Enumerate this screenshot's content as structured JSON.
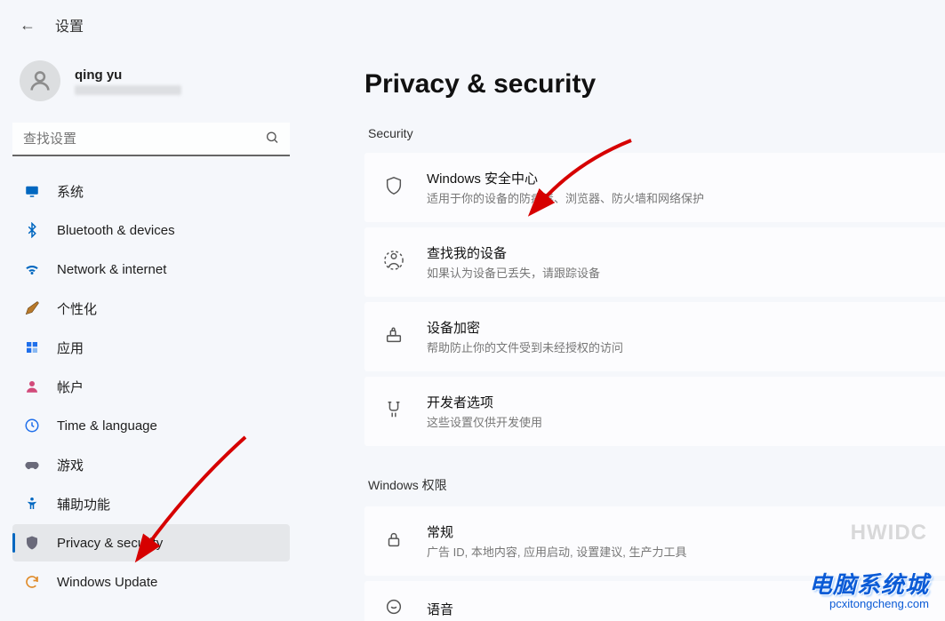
{
  "header": {
    "title": "设置"
  },
  "user": {
    "name": "qing yu"
  },
  "search": {
    "placeholder": "查找设置"
  },
  "nav": [
    {
      "key": "system",
      "label": "系统"
    },
    {
      "key": "bluetooth",
      "label": "Bluetooth & devices"
    },
    {
      "key": "network",
      "label": "Network & internet"
    },
    {
      "key": "personalize",
      "label": "个性化"
    },
    {
      "key": "apps",
      "label": "应用"
    },
    {
      "key": "accounts",
      "label": "帐户"
    },
    {
      "key": "time",
      "label": "Time & language"
    },
    {
      "key": "gaming",
      "label": "游戏"
    },
    {
      "key": "access",
      "label": "辅助功能"
    },
    {
      "key": "privacy",
      "label": "Privacy & security"
    },
    {
      "key": "update",
      "label": "Windows Update"
    }
  ],
  "page": {
    "title": "Privacy & security",
    "section_security": "Security",
    "section_winperm": "Windows 权限",
    "cards": {
      "winsec": {
        "title": "Windows 安全中心",
        "desc": "适用于你的设备的防病毒、浏览器、防火墙和网络保护"
      },
      "findmy": {
        "title": "查找我的设备",
        "desc": "如果认为设备已丢失，请跟踪设备"
      },
      "encrypt": {
        "title": "设备加密",
        "desc": "帮助防止你的文件受到未经授权的访问"
      },
      "dev": {
        "title": "开发者选项",
        "desc": "这些设置仅供开发使用"
      },
      "general": {
        "title": "常规",
        "desc": "广告 ID, 本地内容, 应用启动, 设置建议, 生产力工具"
      },
      "speech": {
        "title": "语音"
      }
    }
  },
  "watermark": {
    "brand": "电脑系统城",
    "url": "pcxitongcheng.com",
    "ghost": "HWIDC"
  }
}
